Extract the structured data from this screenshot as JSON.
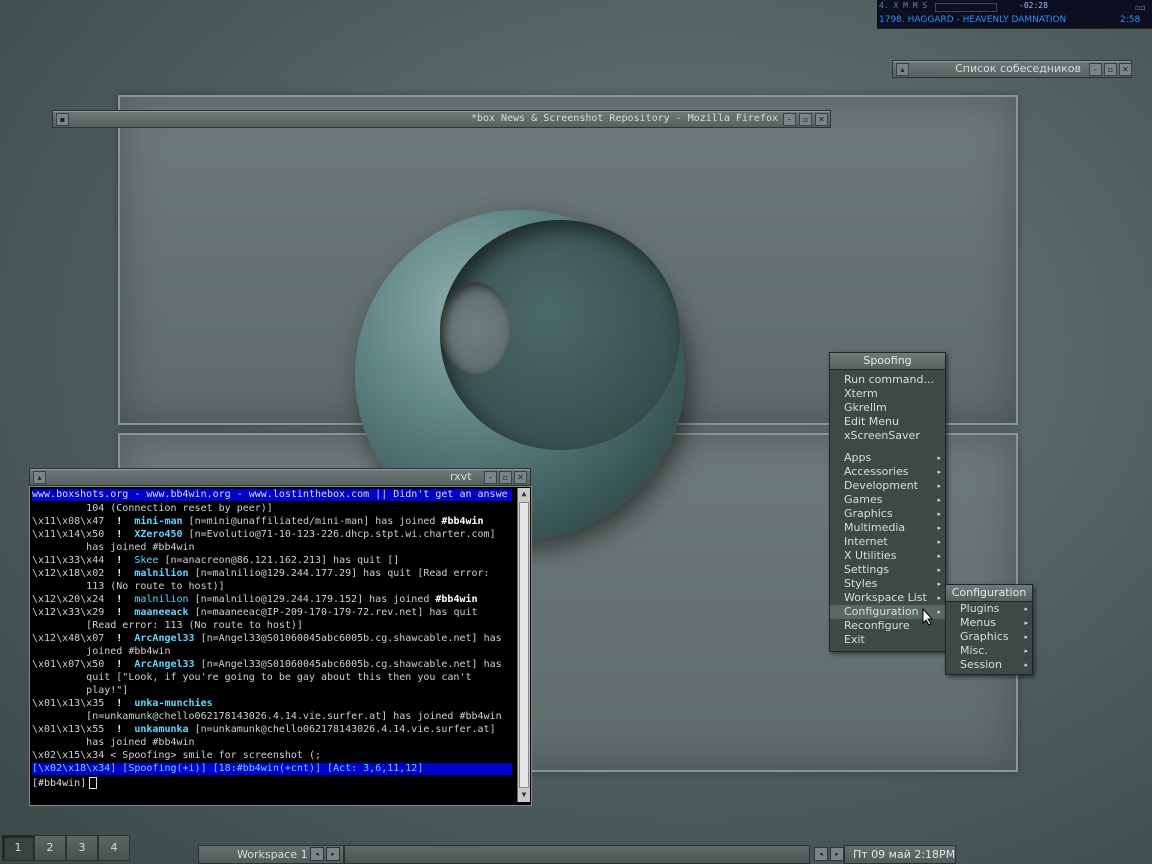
{
  "xmms": {
    "controls": "4. X M M S",
    "time": "-02:28",
    "track": "1798. HAGGARD - HEAVENLY DAMNATION",
    "length": "2:58"
  },
  "contacts_window": {
    "title": "Список собеседников"
  },
  "firefox_window": {
    "title": "*box News & Screenshot Repository - Mozilla Firefox"
  },
  "rxvt": {
    "title": "rxvt",
    "topic": "www.boxshots.org - www.bb4win.org - www.lostinthebox.com || Didn't get an answe",
    "lines": [
      {
        "t": "         104 (Connection reset by peer)]"
      },
      {
        "ts": "\\x11\\x08\\x47",
        "nick": "mini-man",
        "rest": " [n=mini@unaffiliated/mini-man] has joined ",
        "chan": "#bb4win"
      },
      {
        "ts": "\\x11\\x14\\x50",
        "nick": "XZero450",
        "rest": " [n=Evolutio@71-10-123-226.dhcp.stpt.wi.charter.com]"
      },
      {
        "t": "         has joined #bb4win"
      },
      {
        "ts": "\\x11\\x33\\x44",
        "nick": "Skee",
        "rest": " [n=anacreon@86.121.162.213] has quit []"
      },
      {
        "ts": "\\x12\\x18\\x02",
        "nick": "malnilion",
        "rest": " [n=malnilio@129.244.177.29] has quit [Read error:"
      },
      {
        "t": "         113 (No route to host)]"
      },
      {
        "ts": "\\x12\\x20\\x24",
        "nick": "malnilion",
        "rest": " [n=malnilio@129.244.179.152] has joined ",
        "chan": "#bb4win"
      },
      {
        "ts": "\\x12\\x33\\x29",
        "nick": "maaneeack",
        "rest": " [n=maaneeac@IP-209-170-179-72.rev.net] has quit"
      },
      {
        "t": "         [Read error: 113 (No route to host)]"
      },
      {
        "ts": "\\x12\\x48\\x07",
        "nick": "ArcAngel33",
        "rest": " [n=Angel33@S01060045abc6005b.cg.shawcable.net] has"
      },
      {
        "t": "         joined #bb4win"
      },
      {
        "ts": "\\x01\\x07\\x50",
        "nick": "ArcAngel33",
        "rest": " [n=Angel33@S01060045abc6005b.cg.shawcable.net] has"
      },
      {
        "t": "         quit [\"Look, if you're going to be gay about this then you can't"
      },
      {
        "t": "         play!\"]"
      },
      {
        "ts": "\\x01\\x13\\x35",
        "nick": "unka-munchies",
        "rest": ""
      },
      {
        "t": "         [n=unkamunk@chello062178143026.4.14.vie.surfer.at] has joined #bb4win"
      },
      {
        "ts": "\\x01\\x13\\x55",
        "nick": "unkamunka",
        "rest": " [n=unkamunk@chello062178143026.4.14.vie.surfer.at]"
      },
      {
        "t": "         has joined #bb4win"
      },
      {
        "t": "\\x02\\x15\\x34 < Spoofing> smile for screenshot (;"
      }
    ],
    "status": " [\\x02\\x18\\x34] [Spoofing(+i)] [18:#bb4win(+cnt)] [Act: 3,6,11,12]",
    "prompt": "[#bb4win]"
  },
  "root_menu": {
    "title": "Spoofing",
    "group1": [
      "Run command...",
      "Xterm",
      "Gkrellm",
      "Edit Menu",
      "xScreenSaver"
    ],
    "group2": [
      "Apps",
      "Accessories",
      "Development",
      "Games",
      "Graphics",
      "Multimedia",
      "Internet",
      "X Utilities",
      "Settings",
      "Styles",
      "Workspace List",
      "Configuration"
    ],
    "group3": [
      "Reconfigure",
      "Exit"
    ]
  },
  "config_menu": {
    "title": "Configuration",
    "items": [
      "Plugins",
      "Menus",
      "Graphics",
      "Misc.",
      "Session"
    ]
  },
  "taskbar": {
    "workspaces": [
      "1",
      "2",
      "3",
      "4"
    ],
    "workspace_label": "Workspace 1",
    "clock": "Пт 09 май 2:18PM"
  }
}
